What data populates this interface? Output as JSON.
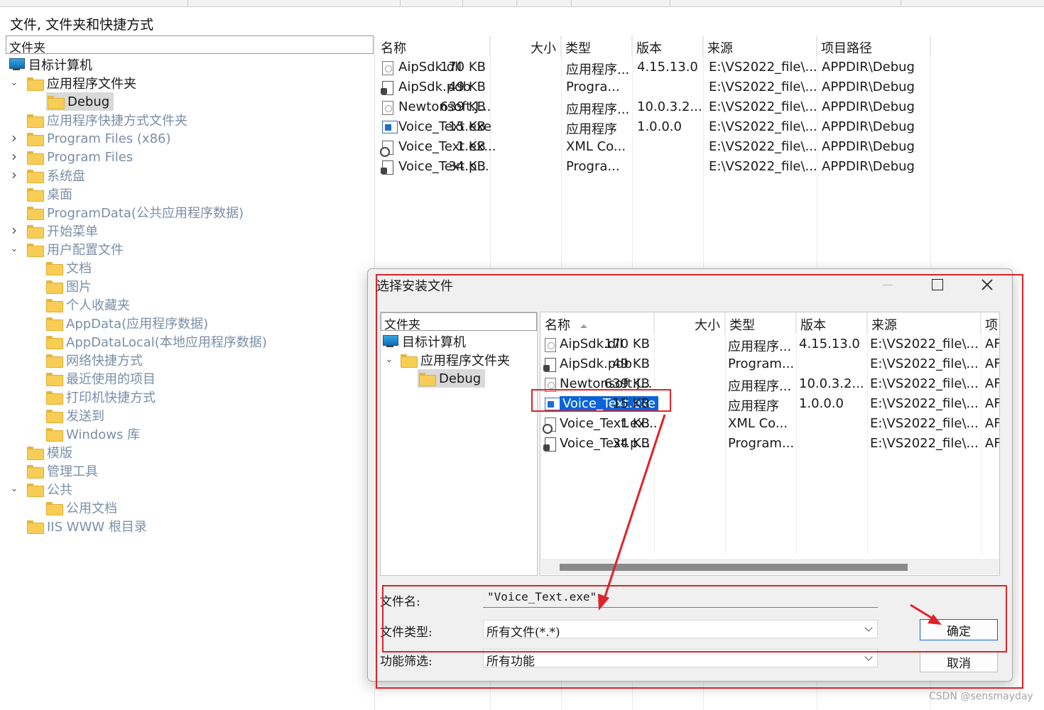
{
  "page": {
    "title": "文件, 文件夹和快捷方式"
  },
  "tree": {
    "header": "文件夹",
    "items": [
      {
        "label": "目标计算机",
        "icon": "computer-icon"
      },
      {
        "label": "应用程序文件夹",
        "icon": "folder-icon"
      },
      {
        "label": "Debug",
        "icon": "folder-icon"
      },
      {
        "label": "应用程序快捷方式文件夹",
        "icon": "folder-icon"
      },
      {
        "label": "Program Files (x86)",
        "icon": "folder-icon"
      },
      {
        "label": "Program Files",
        "icon": "folder-icon"
      },
      {
        "label": "系统盘",
        "icon": "folder-icon"
      },
      {
        "label": "桌面",
        "icon": "folder-icon"
      },
      {
        "label": "ProgramData(公共应用程序数据)",
        "icon": "folder-icon"
      },
      {
        "label": "开始菜单",
        "icon": "folder-icon"
      },
      {
        "label": "用户配置文件",
        "icon": "folder-icon"
      },
      {
        "label": "文档",
        "icon": "folder-icon"
      },
      {
        "label": "图片",
        "icon": "folder-icon"
      },
      {
        "label": "个人收藏夹",
        "icon": "folder-icon"
      },
      {
        "label": "AppData(应用程序数据)",
        "icon": "folder-icon"
      },
      {
        "label": "AppDataLocal(本地应用程序数据)",
        "icon": "folder-icon"
      },
      {
        "label": "网络快捷方式",
        "icon": "folder-icon"
      },
      {
        "label": "最近使用的项目",
        "icon": "folder-icon"
      },
      {
        "label": "打印机快捷方式",
        "icon": "folder-icon"
      },
      {
        "label": "发送到",
        "icon": "folder-icon"
      },
      {
        "label": "Windows 库",
        "icon": "folder-icon"
      },
      {
        "label": "模版",
        "icon": "folder-icon"
      },
      {
        "label": "管理工具",
        "icon": "folder-icon"
      },
      {
        "label": "公共",
        "icon": "folder-icon"
      },
      {
        "label": "公用文档",
        "icon": "folder-icon"
      },
      {
        "label": "IIS WWW 根目录",
        "icon": "folder-icon"
      }
    ]
  },
  "files": {
    "columns": [
      "名称",
      "大小",
      "类型",
      "版本",
      "来源",
      "项目路径"
    ],
    "rows": [
      {
        "name": "AipSdk.dll",
        "size": "170 KB",
        "type": "应用程序...",
        "version": "4.15.13.0",
        "source": "E:\\VS2022_file\\...",
        "path": "APPDIR\\Debug",
        "icon": "dll-file-icon"
      },
      {
        "name": "AipSdk.pdb",
        "size": "49 KB",
        "type": "Progra...",
        "version": "",
        "source": "E:\\VS2022_file\\...",
        "path": "APPDIR\\Debug",
        "icon": "pdb-file-icon"
      },
      {
        "name": "Newtonsoft.J...",
        "size": "639 KB",
        "type": "应用程序...",
        "version": "10.0.3.2...",
        "source": "E:\\VS2022_file\\...",
        "path": "APPDIR\\Debug",
        "icon": "dll-file-icon"
      },
      {
        "name": "Voice_Text.exe",
        "size": "15 KB",
        "type": "应用程序",
        "version": "1.0.0.0",
        "source": "E:\\VS2022_file\\...",
        "path": "APPDIR\\Debug",
        "icon": "exe-file-icon"
      },
      {
        "name": "Voice_Text.ex...",
        "size": "1 KB",
        "type": "XML Co...",
        "version": "",
        "source": "E:\\VS2022_file\\...",
        "path": "APPDIR\\Debug",
        "icon": "xml-file-icon"
      },
      {
        "name": "Voice_Text.p...",
        "size": "34 KB",
        "type": "Progra...",
        "version": "",
        "source": "E:\\VS2022_file\\...",
        "path": "APPDIR\\Debug",
        "icon": "pdb-file-icon"
      }
    ]
  },
  "dialog": {
    "title": "选择安装文件",
    "tree_header": "文件夹",
    "tree_items": [
      {
        "label": "目标计算机"
      },
      {
        "label": "应用程序文件夹"
      },
      {
        "label": "Debug"
      }
    ],
    "columns": [
      "名称",
      "大小",
      "类型",
      "版本",
      "来源",
      "项"
    ],
    "rows": [
      {
        "name": "AipSdk.dll",
        "size": "170 KB",
        "type": "应用程序...",
        "version": "4.15.13.0",
        "source": "E:\\VS2022_file\\...",
        "path": "AF"
      },
      {
        "name": "AipSdk.pdb",
        "size": "49 KB",
        "type": "Program...",
        "version": "",
        "source": "E:\\VS2022_file\\...",
        "path": "AF"
      },
      {
        "name": "Newtonsoft.J...",
        "size": "639 KB",
        "type": "应用程序...",
        "version": "10.0.3.2...",
        "source": "E:\\VS2022_file\\...",
        "path": "AF"
      },
      {
        "name": "Voice_Text.exe",
        "size": "15 KB",
        "type": "应用程序",
        "version": "1.0.0.0",
        "source": "E:\\VS2022_file\\...",
        "path": "AF",
        "selected": true
      },
      {
        "name": "Voice_Text.ex...",
        "size": "1 KB",
        "type": "XML Co...",
        "version": "",
        "source": "E:\\VS2022_file\\...",
        "path": "AF"
      },
      {
        "name": "Voice_Text.p...",
        "size": "34 KB",
        "type": "Program...",
        "version": "",
        "source": "E:\\VS2022_file\\...",
        "path": "AF"
      }
    ],
    "filename_label": "文件名:",
    "filename_value": "\"Voice_Text.exe\"",
    "filetype_label": "文件类型:",
    "filetype_value": "所有文件(*.*)",
    "filter_label": "功能筛选:",
    "filter_value": "所有功能",
    "ok_label": "确定",
    "cancel_label": "取消"
  },
  "watermark": "CSDN @sensmayday",
  "colors": {
    "selection": "#0a64d8",
    "annotation": "#e0222b",
    "folder": "#f7cd55"
  }
}
